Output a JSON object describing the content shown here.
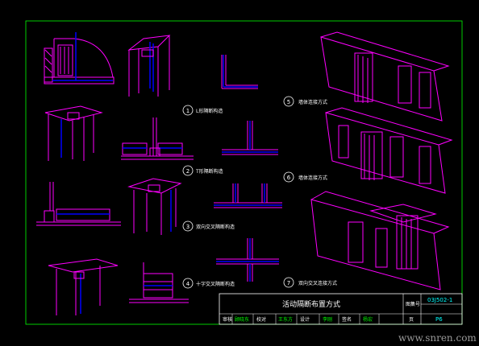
{
  "colors": {
    "background": "#000000",
    "frame": "#00ff00",
    "wall": "#ff00ff",
    "column": "#0000ff",
    "text": "#ffffff",
    "code": "#00ffff",
    "watermark": "#9a9a9a"
  },
  "details": [
    {
      "num": "1",
      "label": "L形隔断构造"
    },
    {
      "num": "2",
      "label": "T形隔断构造"
    },
    {
      "num": "3",
      "label": "双向交叉隔断构造"
    },
    {
      "num": "4",
      "label": "十字交叉隔断构造"
    },
    {
      "num": "5",
      "label": "墙体连接方式"
    },
    {
      "num": "6",
      "label": "墙体连接方式"
    },
    {
      "num": "7",
      "label": "双向交叉连接方式"
    }
  ],
  "title_block": {
    "title": "活动隔断布置方式",
    "code_label": "图集号",
    "code": "03J502-1",
    "page_label": "页",
    "page": "P6"
  },
  "signatures": [
    {
      "text": "审核"
    },
    {
      "text": "顾晓东"
    },
    {
      "text": "校对"
    },
    {
      "text": "王东方"
    },
    {
      "text": "设计"
    },
    {
      "text": "李刚"
    },
    {
      "text": "签名"
    },
    {
      "text": "杨宏"
    }
  ],
  "watermark": "www.snren.com"
}
